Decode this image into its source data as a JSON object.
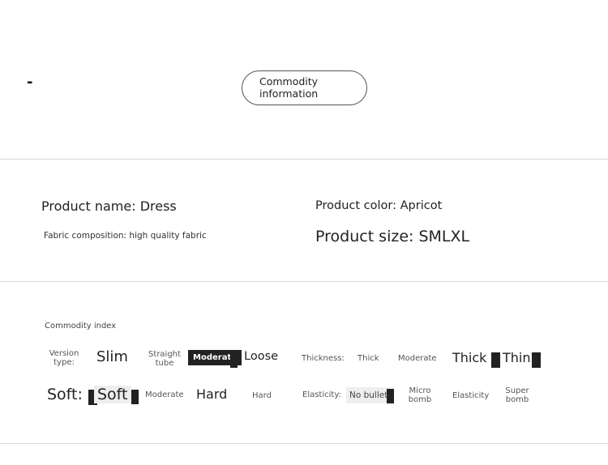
{
  "header": {
    "dash": "-",
    "button_label_line1": "Commodity",
    "button_label_line2": "information"
  },
  "product": {
    "name": "Product name: Dress",
    "color": "Product color: Apricot",
    "fabric": "Fabric composition: high quality fabric",
    "size": "Product size: SMLXL"
  },
  "index": {
    "title": "Commodity index",
    "version_type": {
      "label_line1": "Version",
      "label_line2": "type:",
      "options": [
        "Slim",
        "Straight",
        "tube",
        "Moderate",
        "Loose"
      ],
      "selected": "Moderate"
    },
    "thickness": {
      "label": "Thickness:",
      "options": [
        "Thick",
        "Moderate",
        "Thick",
        "Thin"
      ]
    },
    "soft": {
      "label": "Soft:",
      "options": [
        "Soft",
        "Moderate",
        "Hard",
        "Hard"
      ],
      "selected": "Soft"
    },
    "elasticity": {
      "label": "Elasticity:",
      "options": [
        "No bullet",
        "Micro",
        "bomb",
        "Elasticity",
        "Super",
        "bomb"
      ],
      "selected": "No bullet"
    }
  }
}
